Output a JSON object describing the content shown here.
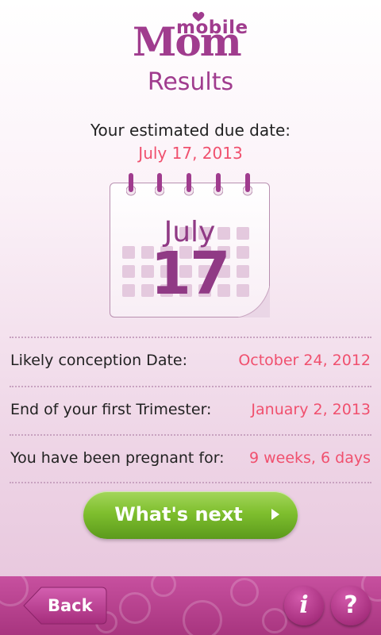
{
  "logo": {
    "small": "mobile",
    "large": "Mom"
  },
  "page_title": "Results",
  "due_date": {
    "label": "Your estimated due date:",
    "value": "July 17, 2013"
  },
  "calendar": {
    "month": "July",
    "day": "17"
  },
  "rows": [
    {
      "label": "Likely conception Date:",
      "value": "October 24, 2012"
    },
    {
      "label": "End of your first Trimester:",
      "value": "January 2, 2013"
    },
    {
      "label": "You have been pregnant for:",
      "value": "9 weeks, 6 days"
    }
  ],
  "next_button": {
    "label": "What's next"
  },
  "bottom_bar": {
    "back_label": "Back",
    "info_glyph": "i",
    "help_glyph": "?"
  },
  "colors": {
    "brand_purple": "#a03c8e",
    "accent_coral": "#f0506e",
    "green": "#7fbf2e",
    "bar_magenta": "#b8408f"
  }
}
